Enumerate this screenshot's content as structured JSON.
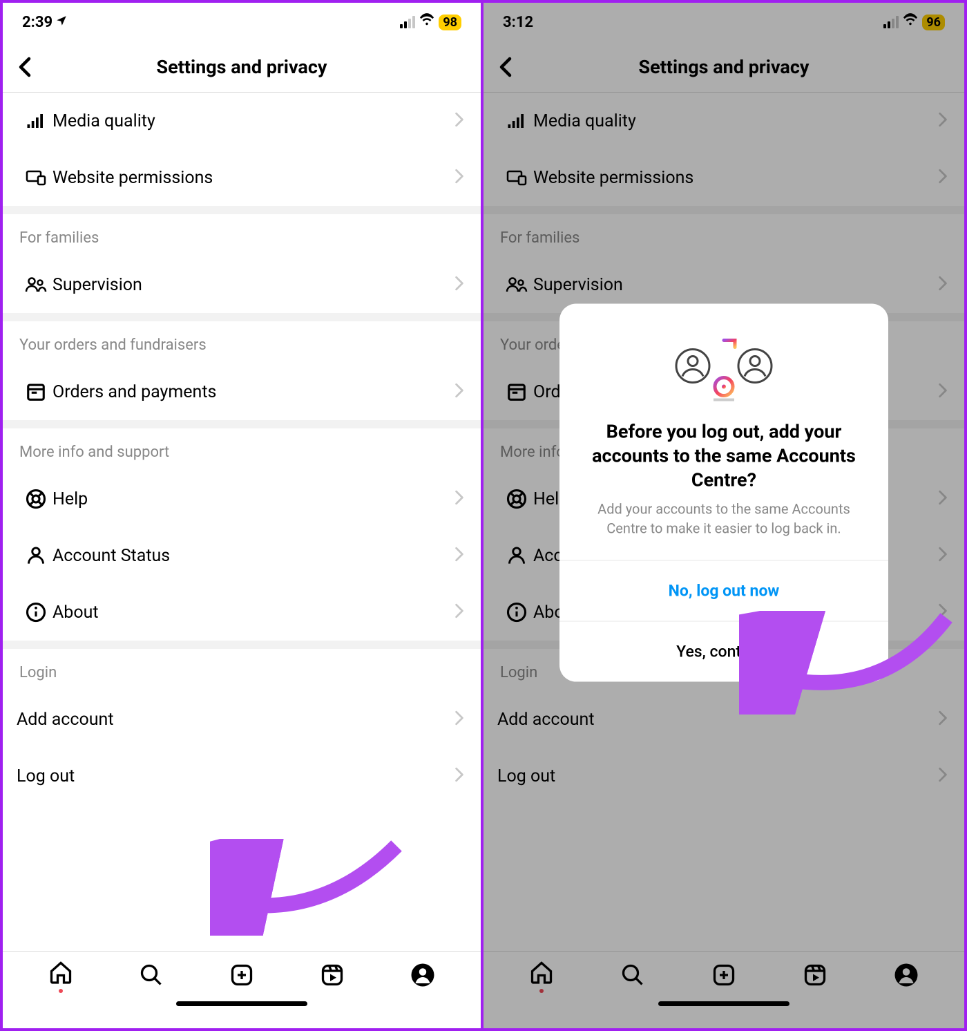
{
  "left": {
    "status": {
      "time": "2:39",
      "battery": "98"
    },
    "header_title": "Settings and privacy",
    "rows": {
      "media_quality": "Media quality",
      "website_permissions": "Website permissions",
      "supervision": "Supervision",
      "orders_payments": "Orders and payments",
      "help": "Help",
      "account_status": "Account Status",
      "about": "About",
      "add_account": "Add account",
      "log_out": "Log out"
    },
    "sections": {
      "for_families": "For families",
      "orders": "Your orders and fundraisers",
      "more_info": "More info and support",
      "login": "Login"
    }
  },
  "right": {
    "status": {
      "time": "3:12",
      "battery": "96"
    },
    "header_title": "Settings and privacy",
    "modal": {
      "title": "Before you log out, add your accounts to the same Accounts Centre?",
      "desc": "Add your accounts to the same Accounts Centre to make it easier to log back in.",
      "primary": "No, log out now",
      "secondary": "Yes, continue"
    }
  }
}
